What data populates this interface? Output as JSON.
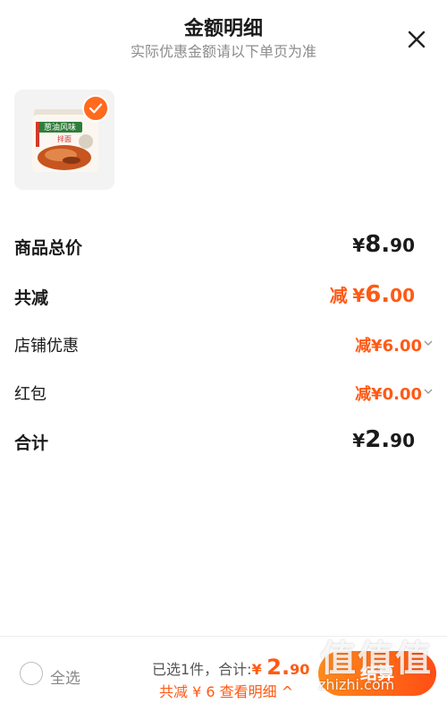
{
  "header": {
    "title": "金额明细",
    "subtitle": "实际优惠金额请以下单页为准"
  },
  "product": {
    "image_label_top": "葱油风味",
    "image_label_bottom": "拌面"
  },
  "details": {
    "total_label": "商品总价",
    "total_yen": "¥",
    "total_int": "8.",
    "total_dec": "90",
    "discount_label": "共减",
    "discount_prefix": "减",
    "discount_yen": "¥",
    "discount_int": "6.",
    "discount_dec": "00",
    "shop_label": "店铺优惠",
    "shop_value": "减¥6.00",
    "redpacket_label": "红包",
    "redpacket_value": "减¥0.00",
    "sum_label": "合计",
    "sum_yen": "¥",
    "sum_int": "2.",
    "sum_dec": "90"
  },
  "footer": {
    "select_all": "全选",
    "selected_text": "已选1件，合计:",
    "selected_yen": "¥ ",
    "selected_amount": "2.",
    "selected_dec": "90",
    "discount_text": "共减 ¥ 6  查看明细 ^",
    "checkout": "结算",
    "watermark_chars": "值值值",
    "watermark_url": "zhizhi.com"
  },
  "colors": {
    "accent": "#ff5a14",
    "checkmark_bg": "#ff6a1f"
  }
}
